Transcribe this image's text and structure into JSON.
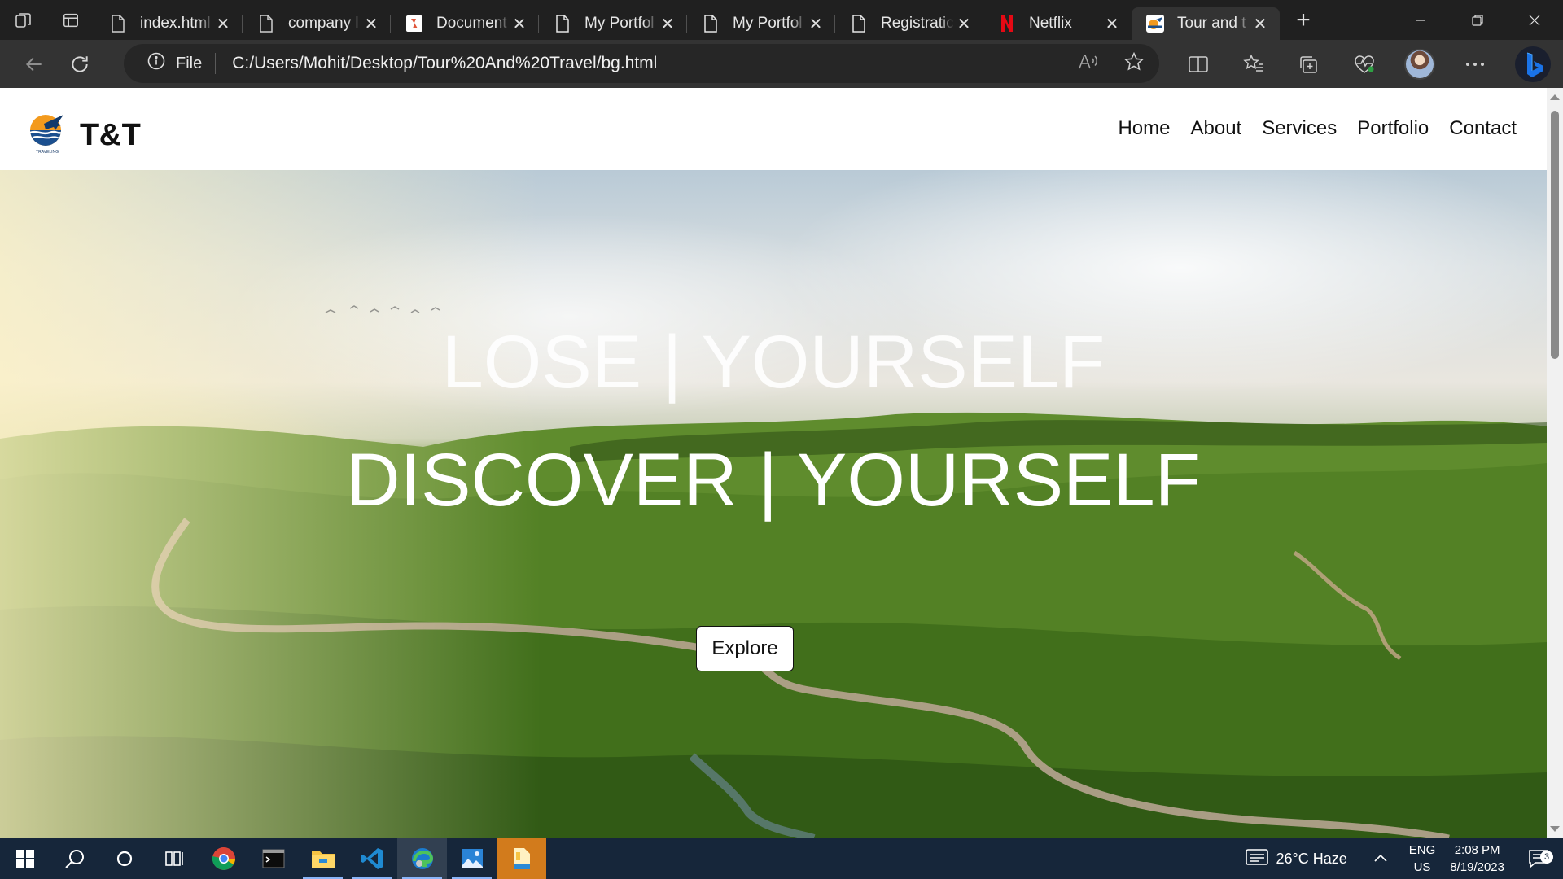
{
  "browser": {
    "tabs": [
      {
        "title": "index.html",
        "icon": "file-icon"
      },
      {
        "title": "company l",
        "icon": "file-icon"
      },
      {
        "title": "Document",
        "icon": "document-favicon"
      },
      {
        "title": "My Portfol",
        "icon": "file-icon"
      },
      {
        "title": "My Portfol",
        "icon": "file-icon"
      },
      {
        "title": "Registratic",
        "icon": "file-icon"
      },
      {
        "title": "Netflix",
        "icon": "netflix-favicon"
      },
      {
        "title": "Tour and t",
        "icon": "tour-favicon",
        "active": true
      }
    ],
    "address": {
      "scheme_label": "File",
      "url": "C:/Users/Mohit/Desktop/Tour%20And%20Travel/bg.html"
    }
  },
  "page": {
    "brand": "T&T",
    "logo_caption": "TRAVELING",
    "nav": [
      "Home",
      "About",
      "Services",
      "Portfolio",
      "Contact"
    ],
    "hero": {
      "line1": "LOSE | YOURSELF",
      "line2": "DISCOVER | YOURSELF",
      "button": "Explore"
    }
  },
  "taskbar": {
    "weather": "26°C  Haze",
    "lang": "ENG",
    "region": "US",
    "time": "2:08 PM",
    "date": "8/19/2023",
    "notifications": "3"
  },
  "colors": {
    "browser_bg": "#202020",
    "toolbar_bg": "#333333",
    "taskbar_bg": "#16263a",
    "netflix_red": "#e50914",
    "bing_blue": "#1a73e8"
  }
}
